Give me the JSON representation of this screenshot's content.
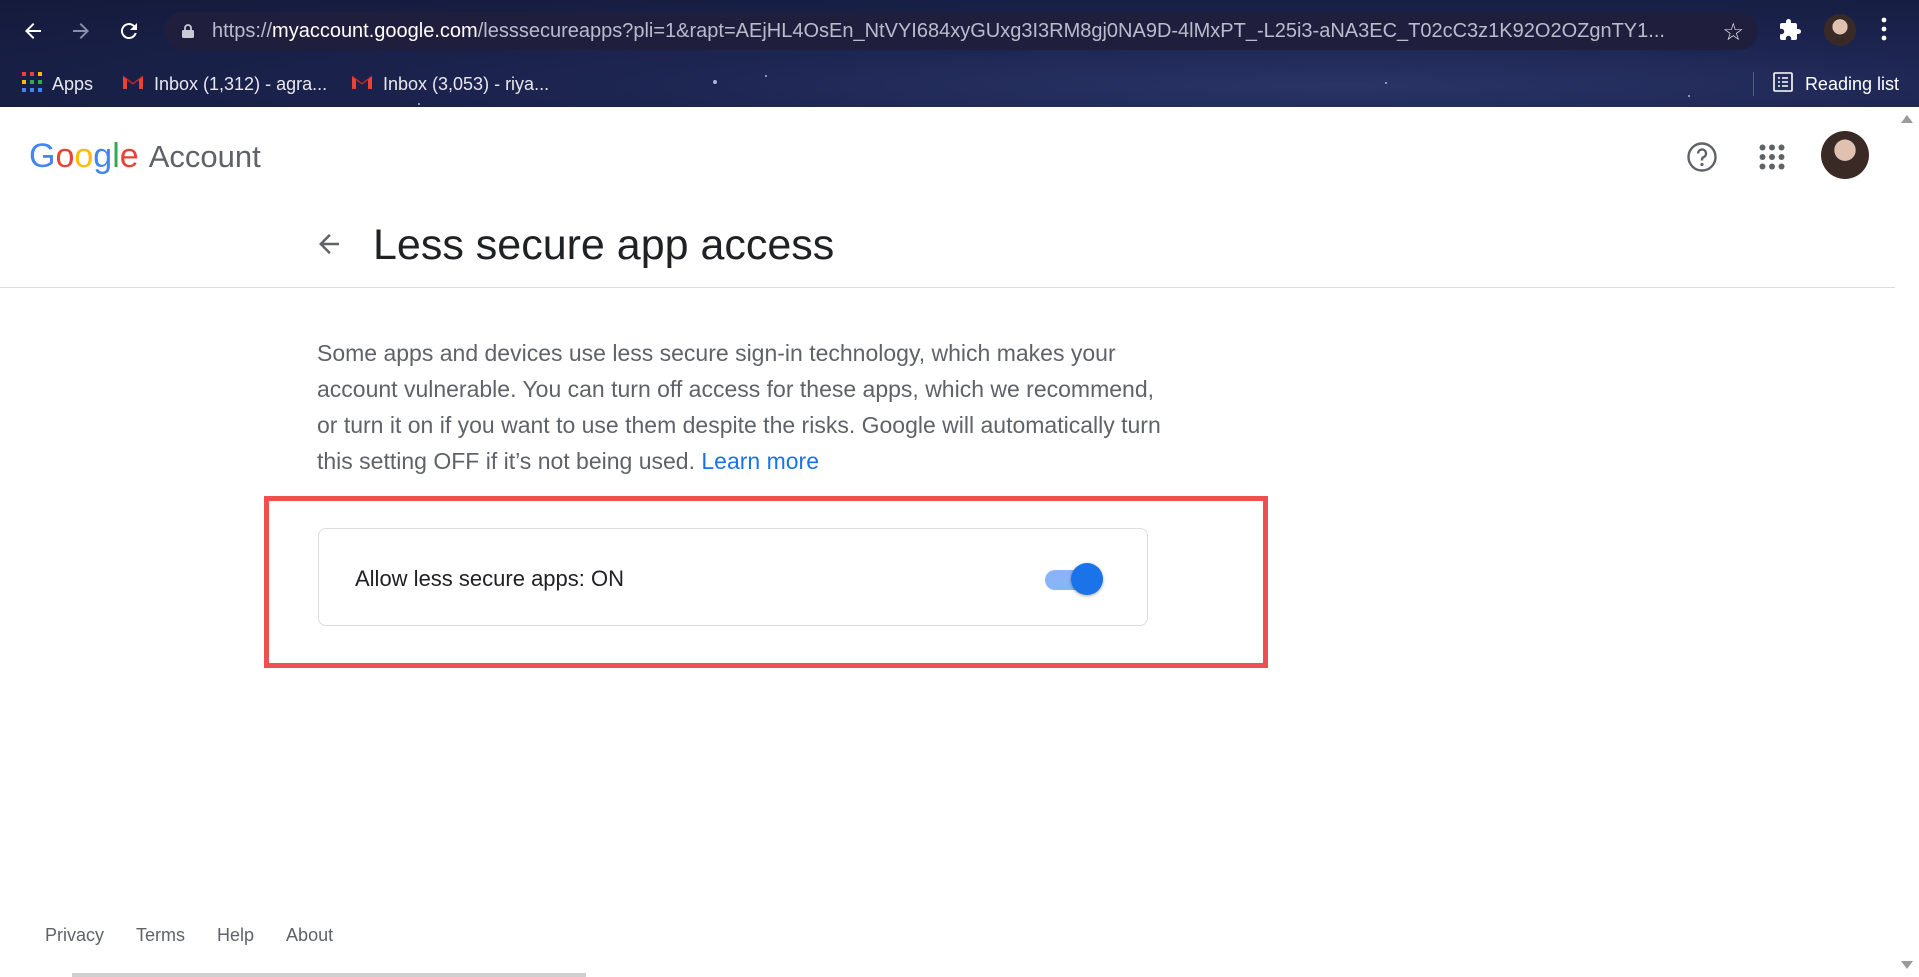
{
  "browser": {
    "url_scheme": "https://",
    "url_host": "myaccount.google.com",
    "url_path": "/lesssecureapps?pli=1&rapt=AEjHL4OsEn_NtVYI684xyGUxg3I3RM8gj0NA9D-4lMxPT_-L25i3-aNA3EC_T02cC3z1K92O2OZgnTY1...",
    "bookmarks": [
      {
        "label": "Apps"
      },
      {
        "label": "Inbox (1,312) - agra..."
      },
      {
        "label": "Inbox (3,053) - riya..."
      }
    ],
    "reading_list": "Reading list"
  },
  "header": {
    "logo_letters": [
      "G",
      "o",
      "o",
      "g",
      "l",
      "e"
    ],
    "logo_colors": [
      "#4285f4",
      "#ea4335",
      "#fbbc05",
      "#4285f4",
      "#34a853",
      "#ea4335"
    ],
    "account_label": "Account"
  },
  "main": {
    "title": "Less secure app access",
    "description": "Some apps and devices use less secure sign-in technology, which makes your account vulnerable. You can turn off access for these apps, which we recommend, or turn it on if you want to use them despite the risks. Google will automatically turn this setting OFF if it’s not being used.",
    "learn_more": "Learn more",
    "setting_label": "Allow less secure apps: ON",
    "toggle_on": true
  },
  "footer": {
    "links": [
      "Privacy",
      "Terms",
      "Help",
      "About"
    ]
  },
  "colors": {
    "accent": "#1a73e8",
    "highlight_border": "#ef4f4f"
  }
}
